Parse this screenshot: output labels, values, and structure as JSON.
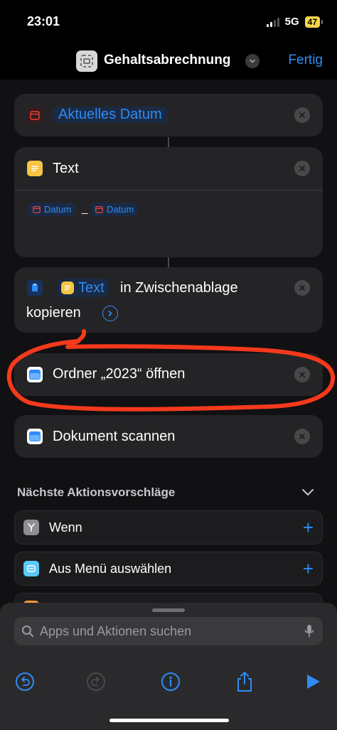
{
  "status": {
    "time": "23:01",
    "network": "5G",
    "battery": "47"
  },
  "header": {
    "title": "Gehaltsabrechnung",
    "done": "Fertig"
  },
  "actions": [
    {
      "label": "Aktuelles Datum"
    },
    {
      "label": "Text",
      "tokens": [
        "Datum",
        "_",
        "Datum"
      ]
    },
    {
      "var": "Text",
      "text_after": "in Zwischenablage",
      "line2": "kopieren"
    },
    {
      "label": "Ordner „2023“ öffnen"
    },
    {
      "label": "Dokument scannen"
    }
  ],
  "suggestions": {
    "title": "Nächste Aktionsvorschläge",
    "items": [
      {
        "label": "Wenn"
      },
      {
        "label": "Aus Menü auswählen"
      }
    ]
  },
  "search": {
    "placeholder": "Apps und Aktionen suchen"
  },
  "colors": {
    "accent": "#2e8cf5",
    "annotation": "#f5391d",
    "calendar": "#e5443a",
    "text_yellow": "#f6c543"
  }
}
